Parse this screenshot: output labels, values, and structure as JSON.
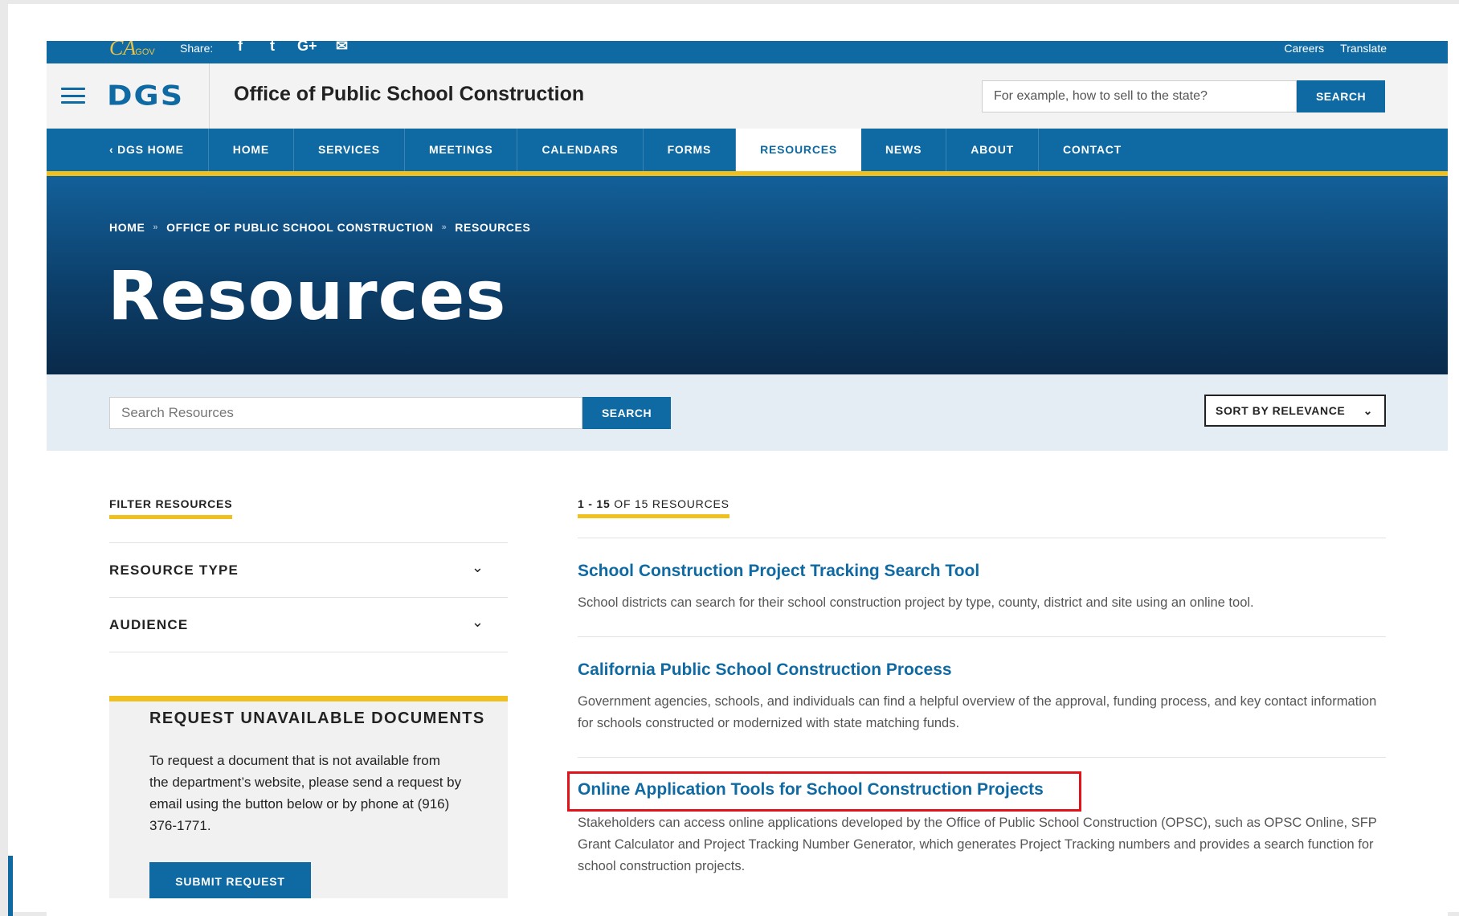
{
  "utility": {
    "cagov": "CA",
    "cagov_suffix": ".GOV",
    "share_label": "Share:",
    "share_icons": [
      "f",
      "t",
      "G+",
      "✉"
    ],
    "links": [
      "Careers",
      "Translate"
    ]
  },
  "header": {
    "logo": "DGS",
    "title": "Office of Public School Construction",
    "search_placeholder": "For example, how to sell to the state?",
    "search_button": "SEARCH"
  },
  "nav": {
    "items": [
      "‹ DGS HOME",
      "HOME",
      "SERVICES",
      "MEETINGS",
      "CALENDARS",
      "FORMS",
      "RESOURCES",
      "NEWS",
      "ABOUT",
      "CONTACT"
    ],
    "active": "RESOURCES"
  },
  "breadcrumb": [
    "HOME",
    "OFFICE OF PUBLIC SCHOOL CONSTRUCTION",
    "RESOURCES"
  ],
  "hero": {
    "title": "Resources"
  },
  "search": {
    "placeholder": "Search Resources",
    "button": "SEARCH",
    "sort_label": "SORT BY RELEVANCE"
  },
  "sidebar": {
    "filter_heading": "FILTER RESOURCES",
    "facets": [
      "RESOURCE TYPE",
      "AUDIENCE"
    ],
    "request": {
      "heading": "REQUEST UNAVAILABLE DOCUMENTS",
      "body": "To request a document that is not available from the department’s website, please send a request by email using the button below or by phone at (916) 376-1771.",
      "button": "SUBMIT REQUEST"
    }
  },
  "results": {
    "count_range": "1 - 15",
    "count_rest": " OF 15 RESOURCES",
    "items": [
      {
        "title": "School Construction Project Tracking Search Tool",
        "description": "School districts can search for their school construction project by type, county, district and site using an online tool."
      },
      {
        "title": "California Public School Construction Process",
        "description": "Government agencies, schools, and individuals can find a helpful overview of the approval, funding process, and key contact information for schools constructed or modernized with state matching funds."
      },
      {
        "title": "Online Application Tools for School Construction Projects",
        "description": "Stakeholders can access online applications developed by the Office of Public School Construction (OPSC), such as OPSC Online, SFP Grant Calculator and Project Tracking Number Generator, which generates Project Tracking numbers and provides a search function for school construction projects."
      }
    ]
  },
  "colors": {
    "brand_blue": "#0f6aa3",
    "accent_gold": "#f0c01e",
    "highlight_red": "#e0131b"
  }
}
